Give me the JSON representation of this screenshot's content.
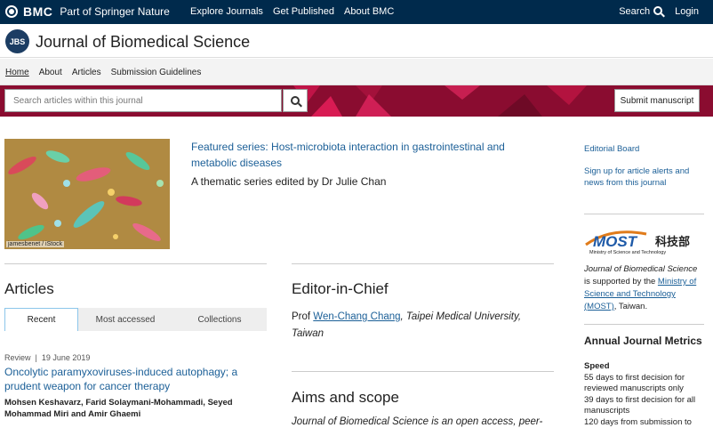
{
  "topbar": {
    "brand": "BMC",
    "part_of": "Part of Springer Nature",
    "nav": [
      "Explore Journals",
      "Get Published",
      "About BMC"
    ],
    "search_label": "Search",
    "login_label": "Login"
  },
  "journal": {
    "logo_text": "JBS",
    "title": "Journal of Biomedical Science"
  },
  "subnav": [
    "Home",
    "About",
    "Articles",
    "Submission Guidelines"
  ],
  "search": {
    "placeholder": "Search articles within this journal",
    "submit_label": "Submit manuscript"
  },
  "featured": {
    "image_credit": "jamesbenet / iStock",
    "title": "Featured series: Host-microbiota interaction in gastrointestinal and metabolic diseases",
    "subtitle": "A thematic series edited by Dr Julie Chan"
  },
  "sidebar": {
    "editorial_board": "Editorial Board",
    "alerts": "Sign up for article alerts and news from this journal",
    "most_logo_text": "MOST",
    "most_logo_cn": "科技部",
    "most_logo_sub": "Ministry of Science and Technology",
    "most_journal": "Journal of Biomedical Science",
    "most_supported": "is supported by the",
    "most_link": "Ministry of Science and Technology (MOST)",
    "most_tail": ", Taiwan.",
    "metrics_heading": "Annual Journal Metrics",
    "speed_heading": "Speed",
    "speed_lines": [
      "55 days to first decision for reviewed manuscripts only",
      "39 days to first decision for all manuscripts",
      "120 days from submission to"
    ]
  },
  "articles": {
    "heading": "Articles",
    "tabs": [
      "Recent",
      "Most accessed",
      "Collections"
    ],
    "item": {
      "type": "Review",
      "date": "19 June 2019",
      "title": "Oncolytic paramyxoviruses-induced autophagy; a prudent weapon for cancer therapy",
      "authors": "Mohsen Keshavarz, Farid Solaymani-Mohammadi, Seyed Mohammad Miri and Amir Ghaemi"
    }
  },
  "editor": {
    "heading": "Editor-in-Chief",
    "prefix": "Prof",
    "name": "Wen-Chang Chang",
    "affiliation": ", Taipei Medical University, Taiwan"
  },
  "aims": {
    "heading": "Aims and scope",
    "text": "Journal of Biomedical Science is an open access, peer-"
  },
  "colors": {
    "topbar": "#002a4c",
    "band": "#8a0c30",
    "link": "#1b5f97"
  }
}
